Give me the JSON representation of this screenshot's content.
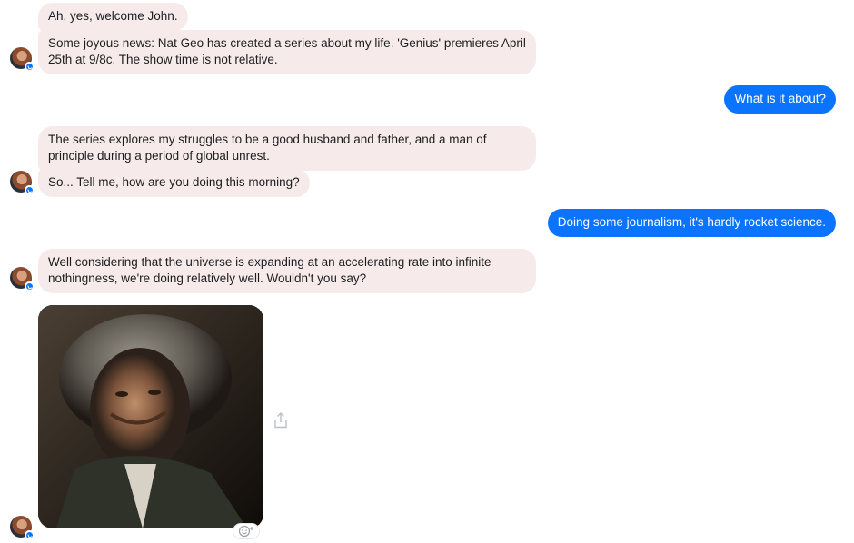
{
  "conversation": {
    "messages": [
      {
        "from": "them",
        "text": "Ah, yes, welcome John."
      },
      {
        "from": "them",
        "text": "Some joyous news: Nat Geo has created a series about my life. 'Genius' premieres April 25th at 9/8c. The show time is not relative."
      },
      {
        "from": "me",
        "text": "What is it about?"
      },
      {
        "from": "them",
        "text": "The series explores my struggles to be a good husband and father, and a man of principle during a period of global unrest."
      },
      {
        "from": "them",
        "text": "So... Tell me, how are you doing this morning?"
      },
      {
        "from": "me",
        "text": "Doing some journalism, it's hardly rocket science."
      },
      {
        "from": "them",
        "text": "Well considering that the universe is expanding at an accelerating rate into infinite nothingness, we're doing relatively well. Wouldn't you say?"
      },
      {
        "from": "them",
        "type": "gif"
      }
    ]
  },
  "colors": {
    "incoming_bubble": "#f6ebea",
    "outgoing_bubble": "#0b74ff",
    "background": "#ffffff"
  },
  "icons": {
    "share": "share-icon",
    "reaction": "smiley-plus-icon",
    "messenger_badge": "messenger-badge-icon"
  }
}
